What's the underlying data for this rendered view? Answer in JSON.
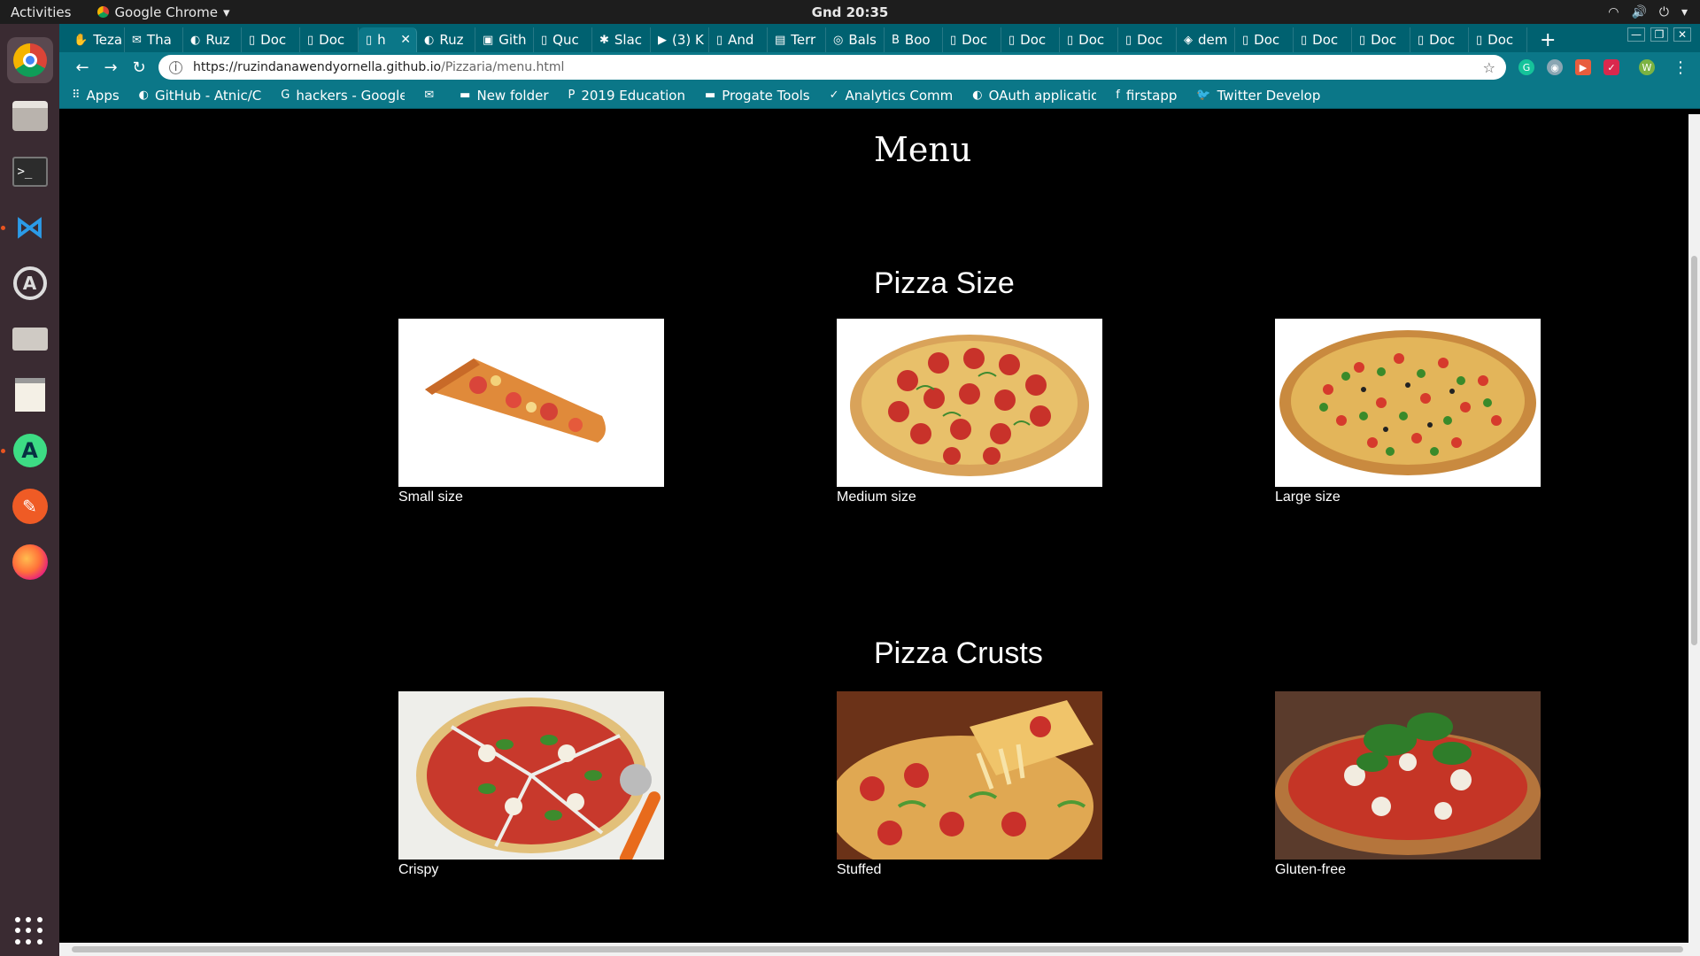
{
  "system": {
    "activities": "Activities",
    "app_name": "Google Chrome",
    "clock": "Gnd 20:35"
  },
  "tabs": [
    {
      "label": "Teza",
      "icon": "hand-icon"
    },
    {
      "label": "Tha",
      "icon": "gmail-icon"
    },
    {
      "label": "Ruz",
      "icon": "github-icon"
    },
    {
      "label": "Doc",
      "icon": "doc-icon"
    },
    {
      "label": "Doc",
      "icon": "doc-icon"
    },
    {
      "label": "h",
      "icon": "doc-icon",
      "active": true
    },
    {
      "label": "Ruz",
      "icon": "github-icon"
    },
    {
      "label": "Gith",
      "icon": "lock-icon"
    },
    {
      "label": "Quc",
      "icon": "doc-icon"
    },
    {
      "label": "Slac",
      "icon": "slack-icon"
    },
    {
      "label": "(3) K",
      "icon": "youtube-icon"
    },
    {
      "label": "And",
      "icon": "doc-icon"
    },
    {
      "label": "Terr",
      "icon": "terminal-icon"
    },
    {
      "label": "Bals",
      "icon": "circle-icon"
    },
    {
      "label": "Boo",
      "icon": "bootstrap-icon"
    },
    {
      "label": "Doc",
      "icon": "doc-icon"
    },
    {
      "label": "Doc",
      "icon": "doc-icon"
    },
    {
      "label": "Doc",
      "icon": "doc-icon"
    },
    {
      "label": "Doc",
      "icon": "doc-icon"
    },
    {
      "label": "dem",
      "icon": "codepen-icon"
    },
    {
      "label": "Doc",
      "icon": "doc-icon"
    },
    {
      "label": "Doc",
      "icon": "doc-icon"
    },
    {
      "label": "Doc",
      "icon": "doc-icon"
    },
    {
      "label": "Doc",
      "icon": "doc-icon"
    },
    {
      "label": "Doc",
      "icon": "doc-icon"
    }
  ],
  "address_bar": {
    "url_host": "https://ruzindanawendyornella.github.io",
    "url_path": "/Pizzaria/menu.html"
  },
  "bookmarks": [
    {
      "label": "Apps",
      "icon": "apps-grid-icon"
    },
    {
      "label": "GitHub - Atnic/C",
      "icon": "github-icon"
    },
    {
      "label": "hackers - Google",
      "icon": "google-icon"
    },
    {
      "label": "",
      "icon": "gmail-icon"
    },
    {
      "label": "New folder",
      "icon": "folder-icon"
    },
    {
      "label": "2019 Education",
      "icon": "p-icon"
    },
    {
      "label": "Progate Tools",
      "icon": "folder-icon"
    },
    {
      "label": "Analytics Comm",
      "icon": "analytics-icon"
    },
    {
      "label": "OAuth applicatio",
      "icon": "github-icon"
    },
    {
      "label": "firstapp",
      "icon": "facebook-icon"
    },
    {
      "label": "Twitter Develop",
      "icon": "twitter-icon"
    }
  ],
  "page": {
    "title": "Menu",
    "sections": [
      {
        "title": "Pizza Size",
        "items": [
          {
            "caption": "Small size",
            "image": "pizza-slice"
          },
          {
            "caption": "Medium size",
            "image": "pepperoni-pizza"
          },
          {
            "caption": "Large size",
            "image": "veggie-pizza"
          }
        ]
      },
      {
        "title": "Pizza Crusts",
        "items": [
          {
            "caption": "Crispy",
            "image": "margherita-crispy"
          },
          {
            "caption": "Stuffed",
            "image": "stuffed-cheese-pull"
          },
          {
            "caption": "Gluten-free",
            "image": "basil-pizza"
          }
        ]
      }
    ]
  },
  "colors": {
    "tab_strip": "#006170",
    "toolbar": "#0b7788",
    "page_bg": "#000000",
    "dock_bg": "#3a2b32"
  }
}
